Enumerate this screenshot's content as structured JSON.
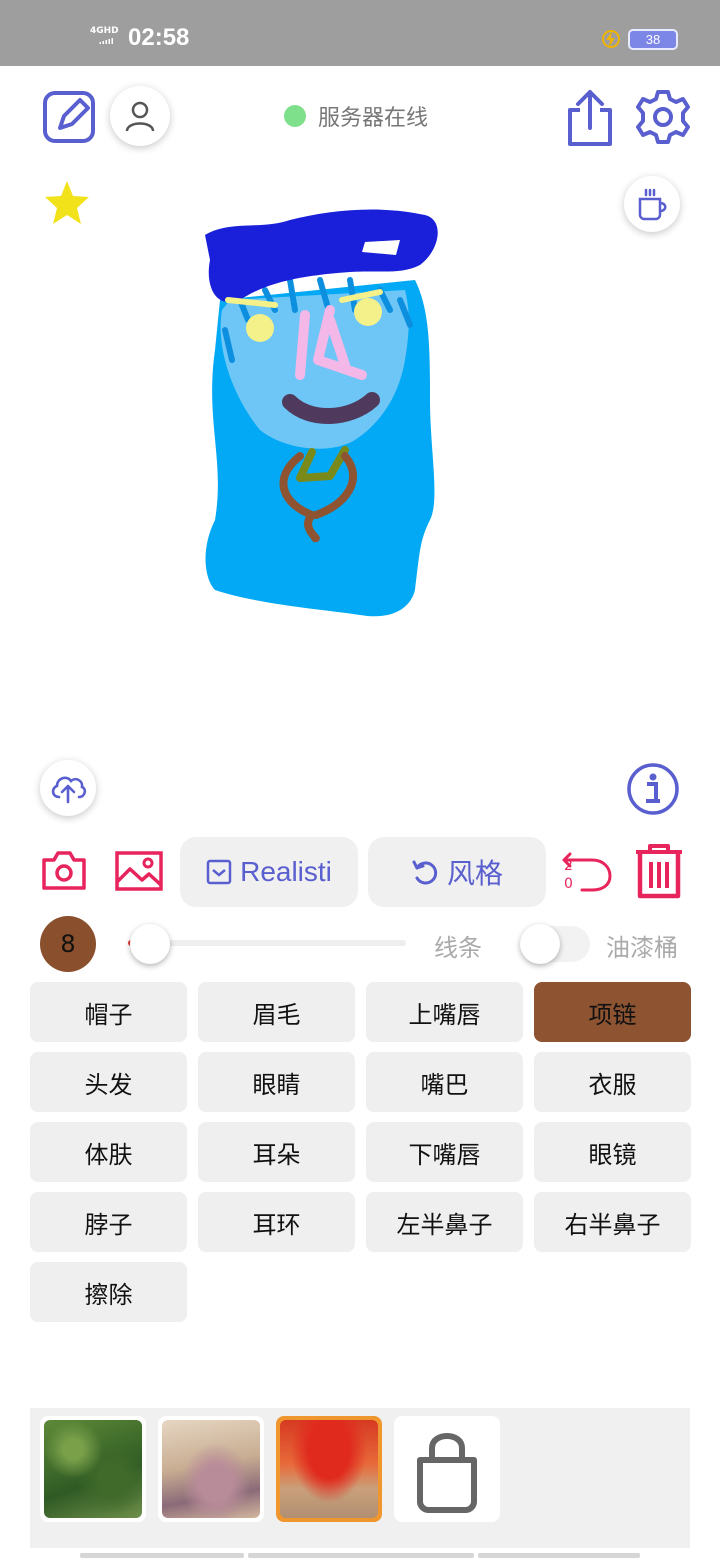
{
  "status_bar": {
    "network": "4GHD",
    "time": "02:58",
    "battery": "38",
    "charge_icon": "charging-bolt-icon"
  },
  "header": {
    "edit_icon": "edit-pen-icon",
    "profile_icon": "user-icon",
    "server_status": "服务器在线",
    "server_status_color": "#7ee08a",
    "share_icon": "share-icon",
    "settings_icon": "gear-icon"
  },
  "canvas": {
    "favorite_icon": "star-icon",
    "coffee_icon": "coffee-cup-icon",
    "upload_icon": "cloud-upload-icon",
    "info_icon": "info-icon"
  },
  "toolbar": {
    "camera_icon": "camera-icon",
    "gallery_icon": "image-icon",
    "style_mode_label": "Realisti",
    "style_button_label": "风格",
    "undo_count_top": "2",
    "undo_count_bottom": "0",
    "delete_icon": "trash-icon",
    "accent_color": "#5a5fcf",
    "danger_color": "#e8245d"
  },
  "brush": {
    "size": "8",
    "size_fraction": 0.08,
    "mode_left_label": "线条",
    "mode_right_label": "油漆桶",
    "current_color": "#8e5432"
  },
  "parts": [
    {
      "label": "帽子",
      "active": false
    },
    {
      "label": "眉毛",
      "active": false
    },
    {
      "label": "上嘴唇",
      "active": false
    },
    {
      "label": "项链",
      "active": true
    },
    {
      "label": "头发",
      "active": false
    },
    {
      "label": "眼睛",
      "active": false
    },
    {
      "label": "嘴巴",
      "active": false
    },
    {
      "label": "衣服",
      "active": false
    },
    {
      "label": "体肤",
      "active": false
    },
    {
      "label": "耳朵",
      "active": false
    },
    {
      "label": "下嘴唇",
      "active": false
    },
    {
      "label": "眼镜",
      "active": false
    },
    {
      "label": "脖子",
      "active": false
    },
    {
      "label": "耳环",
      "active": false
    },
    {
      "label": "左半鼻子",
      "active": false
    },
    {
      "label": "右半鼻子",
      "active": false
    },
    {
      "label": "擦除",
      "active": false
    }
  ],
  "styles": [
    {
      "name": "style-thumb-green-foliage",
      "selected": false
    },
    {
      "name": "style-thumb-rock-flowers",
      "selected": false
    },
    {
      "name": "style-thumb-red-tree",
      "selected": true
    },
    {
      "name": "shop-bag-icon",
      "selected": false
    }
  ]
}
